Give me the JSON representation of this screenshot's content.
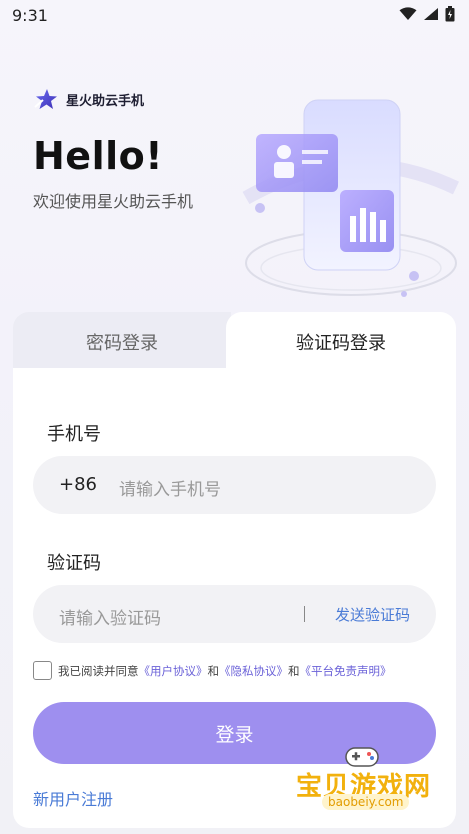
{
  "status_bar": {
    "time": "9:31"
  },
  "brand": {
    "name": "星火助云手机"
  },
  "hero": {
    "greeting": "Hello!",
    "welcome": "欢迎使用星火助云手机"
  },
  "tabs": [
    {
      "label": "密码登录",
      "active": false
    },
    {
      "label": "验证码登录",
      "active": true
    }
  ],
  "form": {
    "phone_label": "手机号",
    "phone_prefix": "+86",
    "phone_placeholder": "请输入手机号",
    "code_label": "验证码",
    "code_placeholder": "请输入验证码",
    "send_code_label": "发送验证码",
    "agreement": {
      "prefix": "我已阅读并同意",
      "user_agreement": "《用户协议》",
      "and1": "和",
      "privacy": "《隐私协议》",
      "and2": "和",
      "disclaimer": "《平台免责声明》"
    },
    "login_label": "登录",
    "register_label": "新用户注册"
  },
  "watermark": {
    "text": "宝贝游戏网",
    "url": "baobeiy.com"
  },
  "colors": {
    "accent": "#9e8fef",
    "link": "#4a7bd6",
    "agreement_link": "#6b62d8"
  }
}
